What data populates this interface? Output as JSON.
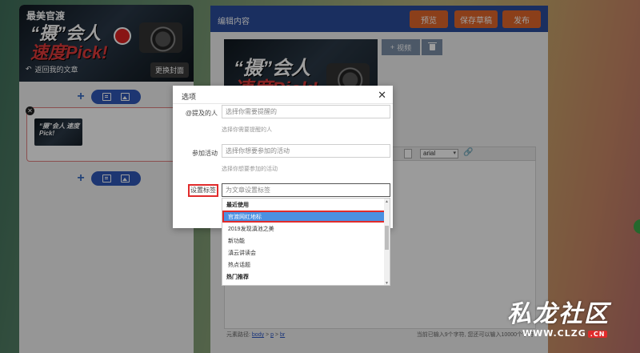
{
  "left_panel": {
    "title": "最美官渡",
    "cover_text_line1": "“摄”会人",
    "cover_text_line2": "速度Pick!",
    "back_label": "返回我的文章",
    "change_cover_label": "更换封面",
    "card_thumb_text": "“摄”会人 速度Pick!"
  },
  "editor": {
    "title": "编辑内容",
    "preview_label": "预览",
    "save_draft_label": "保存草稿",
    "publish_label": "发布",
    "video_label": "视频",
    "font_name": "arial",
    "status_path_label": "元素路径:",
    "status_path": [
      "body",
      "p",
      "br"
    ],
    "status_count": "当前已输入9个字符, 您还可以输入10000个字符"
  },
  "modal": {
    "title": "选项",
    "mention_label": "@提及的人",
    "mention_placeholder": "选择你需要提醒的",
    "mention_hint": "选择你需要提醒的人",
    "activity_label": "参加活动",
    "activity_placeholder": "选择你想要参加的活动",
    "activity_hint": "选择你想要参加的活动",
    "tag_label": "设置标签",
    "tag_placeholder": "为文章设置标签"
  },
  "dropdown": {
    "recent_group": "最近使用",
    "items": [
      "官渡网红地标",
      "2019发现滇池之美",
      "新功能",
      "滇云讲读会",
      "热点话题"
    ],
    "hot_group": "热门推荐",
    "selected_index": 0
  },
  "watermark": {
    "title": "私龙社区",
    "url": "WWW.CLZG",
    "suffix": ".CN"
  },
  "colors": {
    "header_blue": "#2b4c9c",
    "action_orange": "#e0662b",
    "highlight_red": "#e02b2b",
    "selected_blue": "#4a90e2"
  }
}
